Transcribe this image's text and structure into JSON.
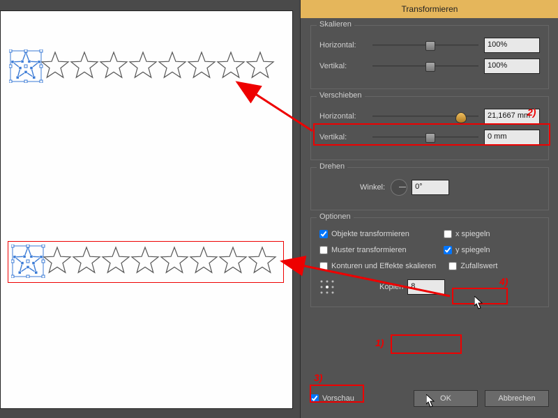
{
  "dialog": {
    "title": "Transformieren",
    "scale": {
      "label": "Skalieren",
      "horizontal_label": "Horizontal:",
      "vertical_label": "Vertikal:",
      "horizontal_value": "100%",
      "vertical_value": "100%"
    },
    "move": {
      "label": "Verschieben",
      "horizontal_label": "Horizontal:",
      "vertical_label": "Vertikal:",
      "horizontal_value": "21,1667 mm",
      "vertical_value": "0 mm"
    },
    "rotate": {
      "label": "Drehen",
      "angle_label": "Winkel:",
      "angle_value": "0°"
    },
    "options": {
      "label": "Optionen",
      "transform_objects": "Objekte transformieren",
      "transform_patterns": "Muster transformieren",
      "scale_strokes": "Konturen und Effekte skalieren",
      "mirror_x": "x spiegeln",
      "mirror_y": "y spiegeln",
      "random": "Zufallswert",
      "copies_label": "Kopien",
      "copies_value": "8",
      "checked": {
        "transform_objects": true,
        "transform_patterns": false,
        "scale_strokes": false,
        "mirror_x": false,
        "mirror_y": true,
        "random": false
      }
    },
    "footer": {
      "preview": "Vorschau",
      "preview_checked": true,
      "ok": "OK",
      "cancel": "Abbrechen"
    }
  },
  "annotations": {
    "n1": "1)",
    "n2": "2)",
    "n3": "3)",
    "n4": "4)"
  },
  "canvas": {
    "star_count": 9
  }
}
